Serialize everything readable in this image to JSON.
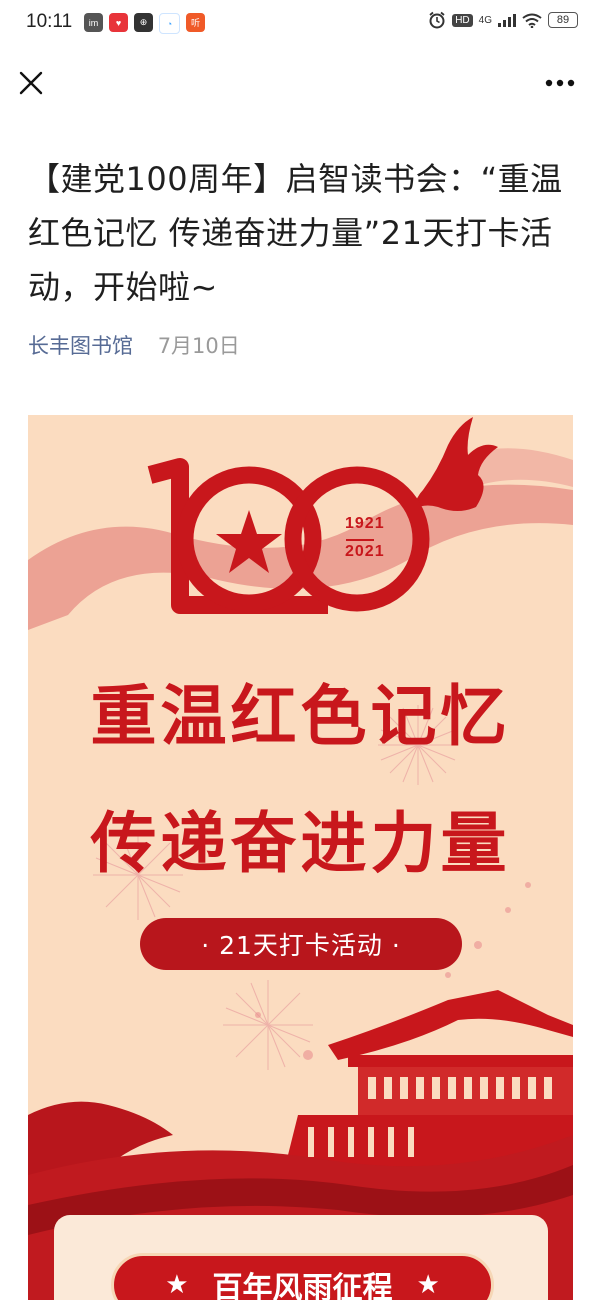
{
  "status_bar": {
    "time": "10:11",
    "network": "4G",
    "battery": "89",
    "app_icons": [
      {
        "name": "app-icon-1",
        "color": "#555555",
        "label": "im"
      },
      {
        "name": "app-icon-2",
        "color": "#e8343a",
        "label": "♥"
      },
      {
        "name": "app-icon-3",
        "color": "#333333",
        "label": "⊕"
      },
      {
        "name": "app-icon-4",
        "color": "#3aa0ff",
        "label": "◔"
      },
      {
        "name": "app-icon-5",
        "color": "#f05a28",
        "label": "听"
      }
    ]
  },
  "article": {
    "title": "【建党100周年】启智读书会：“重温红色记忆 传递奋进力量”21天打卡活动，开始啦~",
    "author": "长丰图书馆",
    "date": "7月10日"
  },
  "poster": {
    "badge_years_top": "1921",
    "badge_years_bottom": "2021",
    "headline_line1": "重温红色记忆",
    "headline_line2": "传递奋进力量",
    "pill_text": "· 21天打卡活动 ·",
    "section_title": "百年风雨征程",
    "colors": {
      "background": "#fbdcc0",
      "accent": "#c8171c",
      "dark_red": "#b8161c"
    }
  }
}
